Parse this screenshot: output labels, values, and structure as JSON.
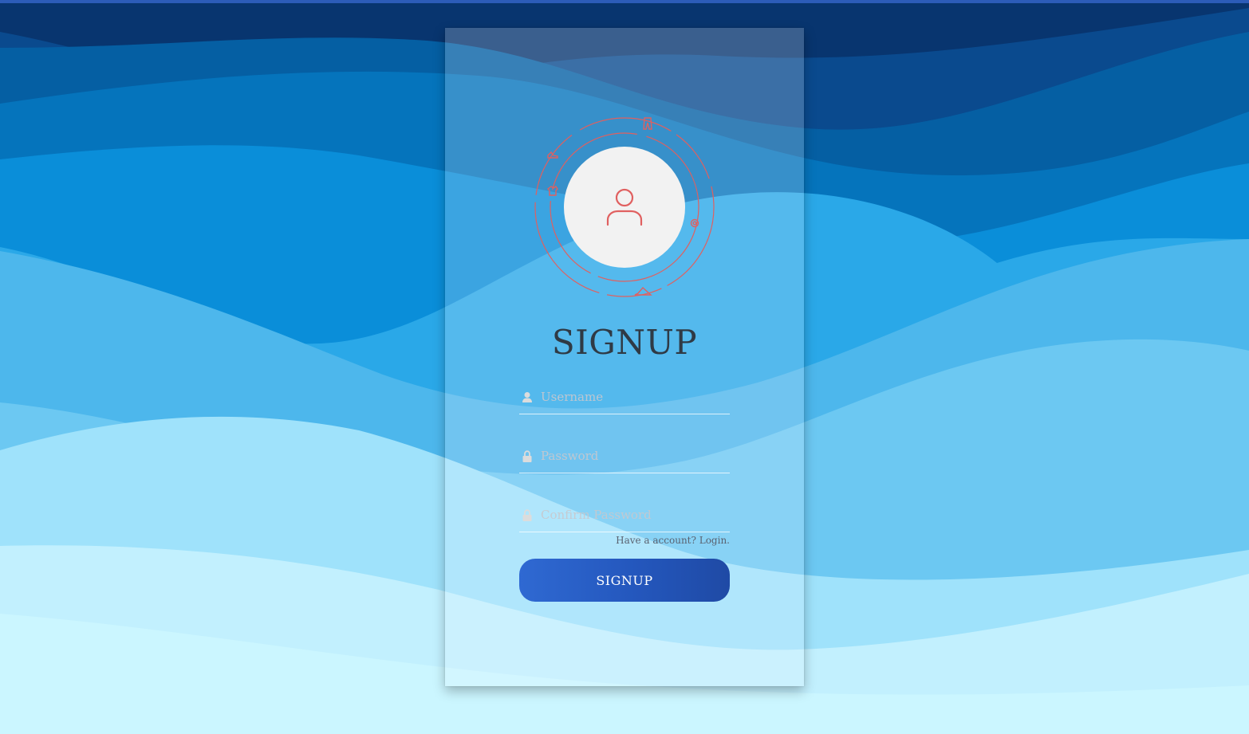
{
  "form": {
    "title": "SIGNUP",
    "username": {
      "placeholder": "Username",
      "value": ""
    },
    "password": {
      "placeholder": "Password",
      "value": ""
    },
    "confirm_password": {
      "placeholder": "Confirm Password",
      "value": ""
    },
    "login_link": "Have a account? Login.",
    "submit_label": "SIGNUP"
  },
  "icons": {
    "avatar": "user-icon",
    "username_field": "user-icon",
    "password_field": "lock-icon",
    "confirm_field": "lock-icon",
    "orbit": [
      "pants-icon",
      "shoe-icon",
      "tshirt-icon",
      "at-icon",
      "hanger-icon"
    ]
  },
  "colors": {
    "accent_red": "#e06060",
    "button_gradient_start": "#2f69d2",
    "button_gradient_end": "#1f4aa5",
    "title_text": "#2f3a45",
    "avatar_circle": "#f2f2f2"
  }
}
